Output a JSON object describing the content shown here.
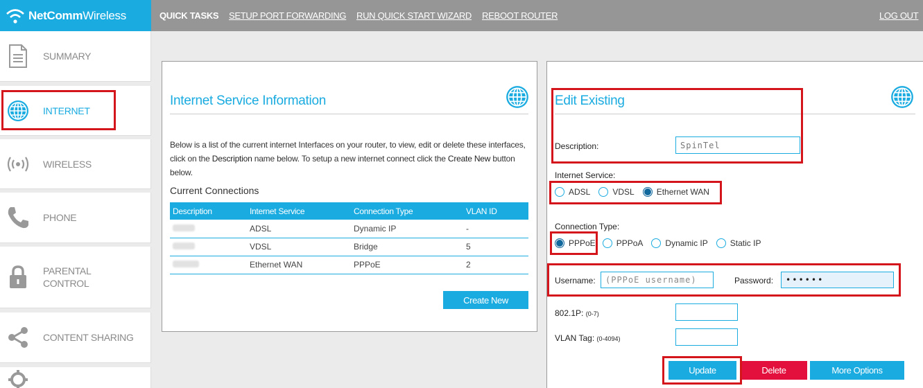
{
  "brand": {
    "logo_bold": "NetComm",
    "logo_thin": "Wireless"
  },
  "topnav": {
    "quick_tasks": "QUICK TASKS",
    "port_forwarding": "SETUP PORT FORWARDING",
    "quick_start": "RUN QUICK START WIZARD",
    "reboot": "REBOOT ROUTER",
    "logout": "LOG OUT"
  },
  "sidebar": {
    "items": [
      {
        "icon": "document-icon",
        "label": "SUMMARY"
      },
      {
        "icon": "globe-icon",
        "label": "INTERNET",
        "active": true
      },
      {
        "icon": "wireless-icon",
        "label": "WIRELESS"
      },
      {
        "icon": "phone-icon",
        "label": "PHONE"
      },
      {
        "icon": "padlock-icon",
        "label_line1": "PARENTAL",
        "label_line2": "CONTROL"
      },
      {
        "icon": "share-icon",
        "label": "CONTENT SHARING"
      },
      {
        "icon": "gear-icon"
      }
    ]
  },
  "info_panel": {
    "title": "Internet Service Information",
    "description_1": "Below is a list of the current internet Interfaces on your router, to view, edit or delete these interfaces, click on the ",
    "description_b1": "Description",
    "description_2": " name below. To setup a new internet connect click the ",
    "description_b2": "Create New",
    "description_3": " button below.",
    "current_connections": "Current Connections",
    "columns": [
      "Description",
      "Internet Service",
      "Connection Type",
      "VLAN ID"
    ],
    "rows": [
      {
        "service": "ADSL",
        "type": "Dynamic IP",
        "vlan": "-"
      },
      {
        "service": "VDSL",
        "type": "Bridge",
        "vlan": "5"
      },
      {
        "service": "Ethernet WAN",
        "type": "PPPoE",
        "vlan": "2"
      }
    ],
    "create_new": "Create New"
  },
  "edit_panel": {
    "title": "Edit Existing",
    "description_label": "Description:",
    "description_value": "SpinTel",
    "internet_service_label": "Internet Service:",
    "services": [
      "ADSL",
      "VDSL",
      "Ethernet WAN"
    ],
    "selected_service": "Ethernet WAN",
    "connection_type_label": "Connection Type:",
    "connection_types": [
      "PPPoE",
      "PPPoA",
      "Dynamic IP",
      "Static IP"
    ],
    "selected_connection": "PPPoE",
    "username_label": "Username:",
    "username_placeholder": "(PPPoE username)",
    "password_label": "Password:",
    "password_value": "••••••",
    "p8021_label": "802.1P:",
    "p8021_hint": "(0-7)",
    "vlan_label": "VLAN Tag:",
    "vlan_hint": "(0-4094)",
    "update": "Update",
    "delete": "Delete",
    "more_options": "More Options"
  },
  "colors": {
    "accent": "#1aabe0",
    "nav_gray": "#969696",
    "danger": "#e30f3c",
    "highlight": "#d4151c"
  }
}
